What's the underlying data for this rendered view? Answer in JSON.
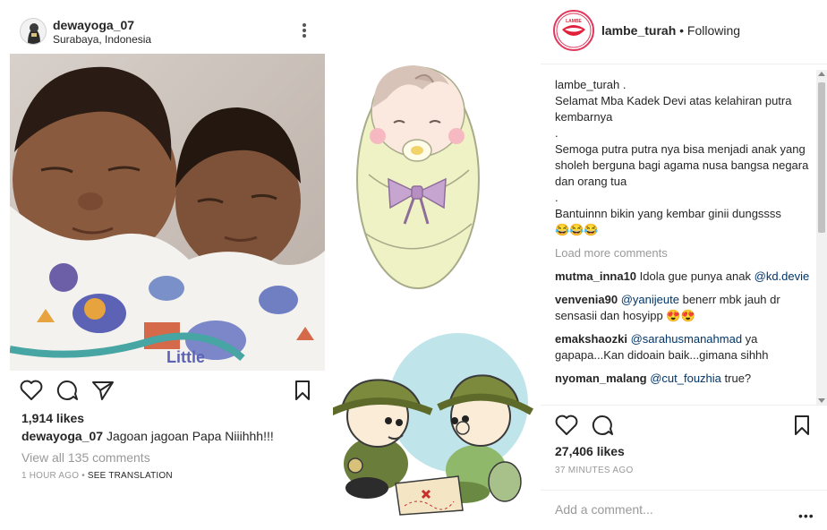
{
  "left_post": {
    "username": "dewayoga_07",
    "location": "Surabaya, Indonesia",
    "likes": "1,914 likes",
    "caption_user": "dewayoga_07",
    "caption_text": "Jagoan jagoan Papa Niiihhh!!!",
    "view_all": "View all 135 comments",
    "timestamp": "1 HOUR AGO",
    "see_translation": "SEE TRANSLATION"
  },
  "right_post": {
    "username": "lambe_turah",
    "follow_status": "• Following",
    "caption_user": "lambe_turah .",
    "caption_lines": [
      "Selamat Mba Kadek Devi atas kelahiran putra kembarnya",
      ".",
      "Semoga putra putra nya bisa menjadi anak yang sholeh berguna bagi agama nusa bangsa negara dan orang tua",
      ".",
      "Bantuinnn bikin yang kembar ginii dungssss",
      "😂😂😂"
    ],
    "load_more": "Load more comments",
    "comments": [
      {
        "user": "mutma_inna10",
        "text": "Idola gue punya anak",
        "mention": "@kd.devie",
        "after": ""
      },
      {
        "user": "venvenia90",
        "text": "",
        "mention": "@yanijeute",
        "after": " benerr mbk jauh dr sensasii dan hosyipp 😍😍"
      },
      {
        "user": "emakshaozki",
        "text": "",
        "mention": "@sarahusmanahmad",
        "after": " ya gapapa...Kan didoain baik...gimana sihhh"
      },
      {
        "user": "nyoman_malang",
        "text": "",
        "mention": "@cut_fouzhia",
        "after": " true?"
      }
    ],
    "likes": "27,406 likes",
    "timestamp": "37 MINUTES AGO",
    "add_comment_placeholder": "Add a comment...",
    "more_label": "•••"
  },
  "icons": {
    "heart": "heart-icon",
    "comment": "comment-icon",
    "share": "share-icon",
    "bookmark": "bookmark-icon",
    "more": "more-icon"
  },
  "colors": {
    "text": "#262626",
    "muted": "#999999",
    "mention": "#003569",
    "divider": "#efefef",
    "brand_ring": "#e03a5e"
  }
}
